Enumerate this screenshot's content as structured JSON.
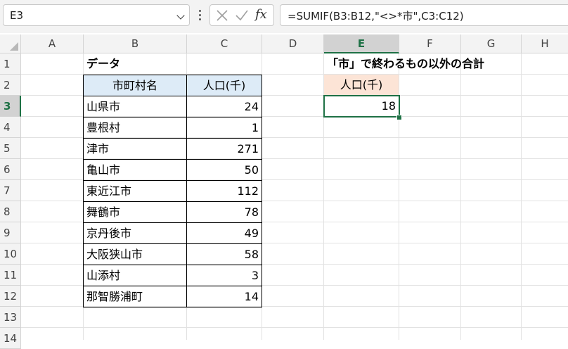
{
  "formula_bar": {
    "name_box": "E3",
    "formula": "=SUMIF(B3:B12,\"<>*市\",C3:C12)",
    "fx_label": "fx"
  },
  "columns": [
    "A",
    "B",
    "C",
    "D",
    "E",
    "F",
    "G",
    "H"
  ],
  "selected_column": "E",
  "rows": [
    "1",
    "2",
    "3",
    "4",
    "5",
    "6",
    "7",
    "8",
    "9",
    "10",
    "11",
    "12",
    "13",
    "14"
  ],
  "selected_row": "3",
  "sheet": {
    "data_title": "データ",
    "table_headers": [
      "市町村名",
      "人口(千)"
    ],
    "table_rows": [
      {
        "name": "山県市",
        "value": "24"
      },
      {
        "name": "豊根村",
        "value": "1"
      },
      {
        "name": "津市",
        "value": "271"
      },
      {
        "name": "亀山市",
        "value": "50"
      },
      {
        "name": "東近江市",
        "value": "112"
      },
      {
        "name": "舞鶴市",
        "value": "78"
      },
      {
        "name": "京丹後市",
        "value": "49"
      },
      {
        "name": "大阪狭山市",
        "value": "58"
      },
      {
        "name": "山添村",
        "value": "3"
      },
      {
        "name": "那智勝浦町",
        "value": "14"
      }
    ],
    "result_title": "「市」で終わるもの以外の合計",
    "result_header": "人口(千)",
    "result_value": "18"
  },
  "colors": {
    "accent_green": "#1e7145",
    "table_header_blue": "#ddebf7",
    "result_header_peach": "#fce4d6"
  }
}
